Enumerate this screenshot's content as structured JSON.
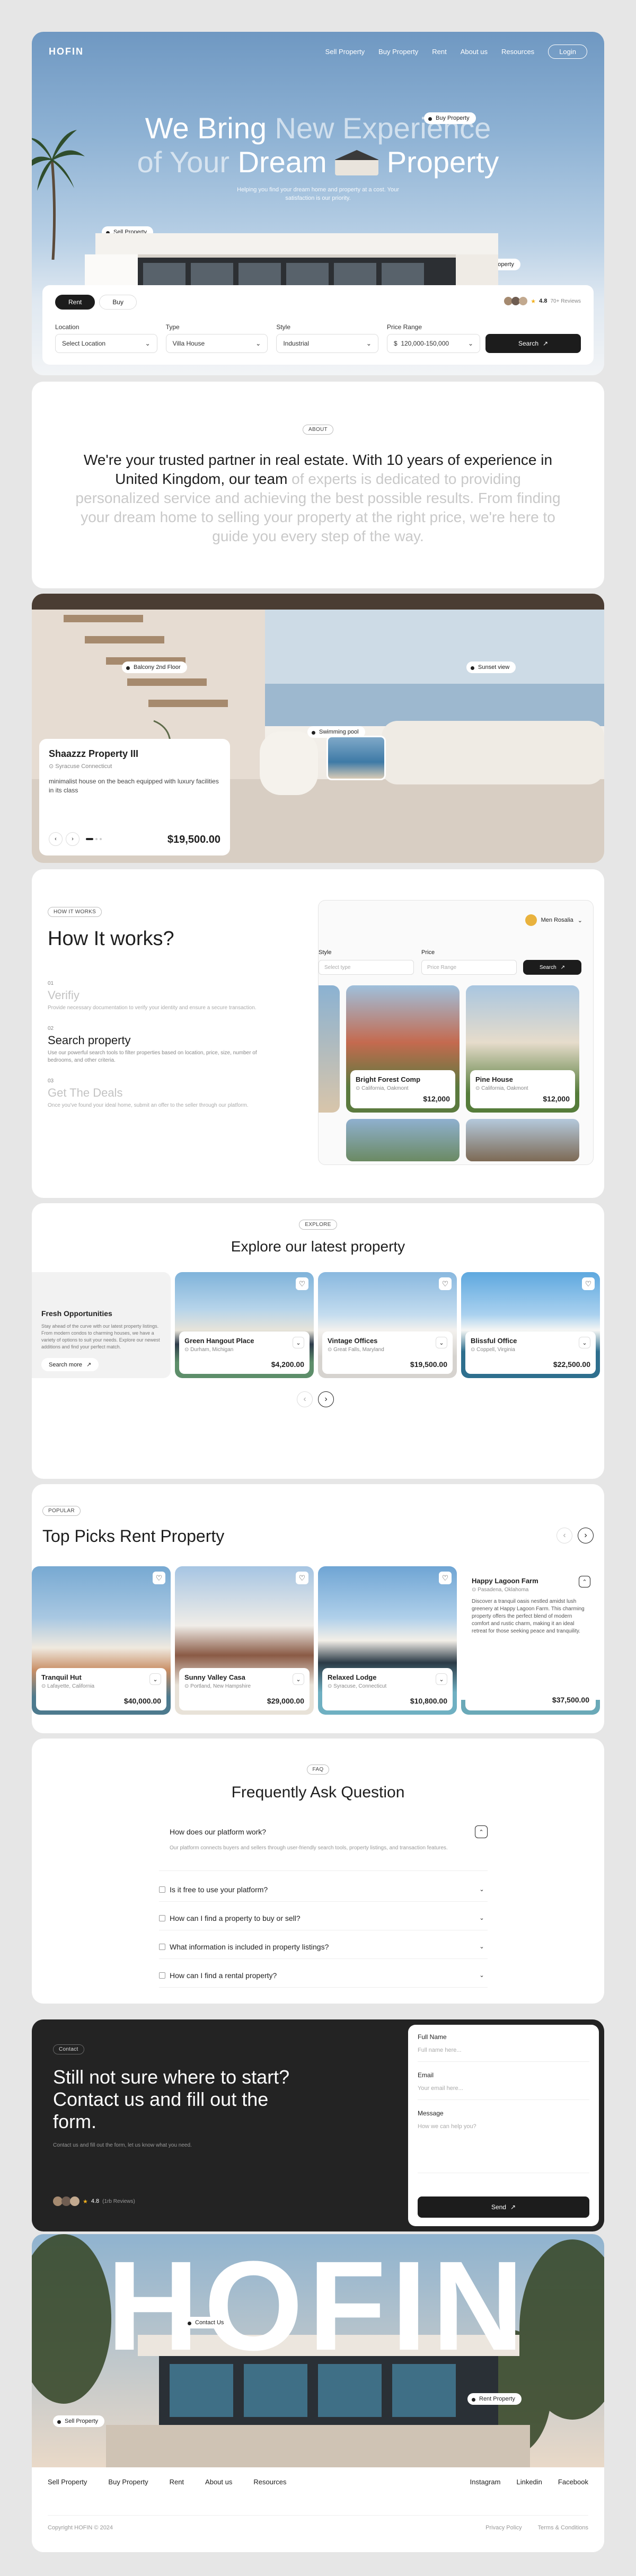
{
  "nav": {
    "logo": "HOFIN",
    "links": [
      "Sell Property",
      "Buy Property",
      "Rent",
      "About us",
      "Resources"
    ],
    "login": "Login"
  },
  "hero": {
    "title_a": "We Bring",
    "title_b": "New Experience",
    "title_c": "of Your",
    "title_d": "Dream",
    "title_e": "Property",
    "subtitle_1": "Helping you find your dream home and property at a cost. Your",
    "subtitle_2": "satisfaction is our priority.",
    "tag_buy": "Buy Property",
    "tag_sell": "Sell Property",
    "tag_rent": "Rent Property",
    "rating": "4.8",
    "rating_label": "70+ Reviews"
  },
  "search": {
    "tab_rent": "Rent",
    "tab_buy": "Buy",
    "location_label": "Location",
    "location_value": "Select Location",
    "type_label": "Type",
    "type_value": "Villa House",
    "style_label": "Style",
    "style_value": "Industrial",
    "price_label": "Price Range",
    "price_value": "120,000-150,000",
    "button": "Search"
  },
  "about": {
    "badge": "ABOUT",
    "text_dark": "We're your trusted partner in real estate. With 10 years of experience in United Kingdom, our team",
    "text_light": "of experts is dedicated to providing personalized service and achieving the best possible results. From finding your dream home to selling your property at the right price, we're here to guide you every step of the way."
  },
  "featured": {
    "tag_balcony": "Balcony 2nd Floor",
    "tag_sunset": "Sunset view",
    "tag_pool": "Swimming pool",
    "name": "Shaazzz Property III",
    "location": "Syracuse Connecticut",
    "desc": "minimalist house on the beach equipped with luxury facilities in its class",
    "price": "$19,500.00"
  },
  "how": {
    "badge": "HOW IT WORKS",
    "title": "How It works?",
    "steps": [
      {
        "num": "01",
        "title": "Verifiy",
        "desc": "Provide necessary documentation to verify your identity and ensure a secure transaction."
      },
      {
        "num": "02",
        "title": "Search property",
        "desc": "Use our powerful search tools to filter properties based on location, price, size, number of bedrooms, and other criteria."
      },
      {
        "num": "03",
        "title": "Get The Deals",
        "desc": "Once you've found your ideal home, submit an offer to the seller through our platform."
      }
    ],
    "mock_user": "Men Rosalia",
    "mock_style": "Style",
    "mock_price": "Price",
    "mock_style_val": "Select type",
    "mock_price_val": "Price Range",
    "mock_search": "Search",
    "mock_cards": [
      {
        "name": "Bright Forest Comp",
        "loc": "California, Oakmont",
        "price": "$12,000"
      },
      {
        "name": "Pine House",
        "loc": "California, Oakmont",
        "price": "$12,000"
      }
    ]
  },
  "explore": {
    "badge": "EXPLORE",
    "title": "Explore our latest property",
    "promo_title": "Fresh Opportunities",
    "promo_desc": "Stay ahead of the curve with our latest property listings. From modern condos to charming houses, we have a variety of options to suit your needs. Explore our newest additions and find your perfect match.",
    "promo_button": "Search more",
    "cards": [
      {
        "name": "Green Hangout Place",
        "loc": "Durham, Michigan",
        "price": "$4,200.00"
      },
      {
        "name": "Vintage Offices",
        "loc": "Great Falls, Maryland",
        "price": "$19,500.00"
      },
      {
        "name": "Blissful Office",
        "loc": "Coppell, Virginia",
        "price": "$22,500.00"
      }
    ]
  },
  "top": {
    "badge": "POPULAR",
    "title": "Top Picks Rent Property",
    "cards": [
      {
        "name": "Tranquil Hut",
        "loc": "Lafayette, California",
        "price": "$40,000.00"
      },
      {
        "name": "Sunny Valley Casa",
        "loc": "Portland, New Hampshire",
        "price": "$29,000.00"
      },
      {
        "name": "Relaxed Lodge",
        "loc": "Syracuse, Connecticut",
        "price": "$10,800.00"
      },
      {
        "name": "Happy Lagoon Farm",
        "loc": "Pasadena, Oklahoma",
        "desc": "Discover a tranquil oasis nestled amidst lush greenery at Happy Lagoon Farm. This charming property offers the perfect blend of modern comfort and rustic charm, making it an ideal retreat for those seeking peace and tranquility.",
        "price": "$37,500.00"
      }
    ]
  },
  "faq": {
    "badge": "FAQ",
    "title": "Frequently Ask Question",
    "items": [
      {
        "q": "How does our platform work?",
        "a": "Our platform connects buyers and sellers through user-friendly search tools, property listings, and transaction features."
      },
      {
        "q": "Is it free to use your platform?"
      },
      {
        "q": "How can I find a property to buy or sell?"
      },
      {
        "q": "What information is included in property listings?"
      },
      {
        "q": "How can I find a rental property?"
      }
    ]
  },
  "contact": {
    "badge": "Contact",
    "title": "Still not sure where to start? Contact us and fill out the form.",
    "sub": "Contact us and fill out the form, let us know what you need.",
    "rating": "4.8",
    "rating_label": "(1rb Reviews)",
    "name_label": "Full Name",
    "name_ph": "Full name here...",
    "email_label": "Email",
    "email_ph": "Your email here...",
    "msg_label": "Message",
    "msg_ph": "How we can help you?",
    "send": "Send"
  },
  "footer": {
    "big": "HOFIN",
    "tag_contact": "Contact Us",
    "tag_sell": "Sell Property",
    "tag_rent": "Rent Property",
    "links": [
      "Sell Property",
      "Buy Property",
      "Rent",
      "About us",
      "Resources"
    ],
    "social": [
      "Instagram",
      "Linkedin",
      "Facebook"
    ],
    "copyright": "Copyright HOFIN © 2024",
    "privacy": "Privacy Policy",
    "terms": "Terms & Conditions"
  }
}
